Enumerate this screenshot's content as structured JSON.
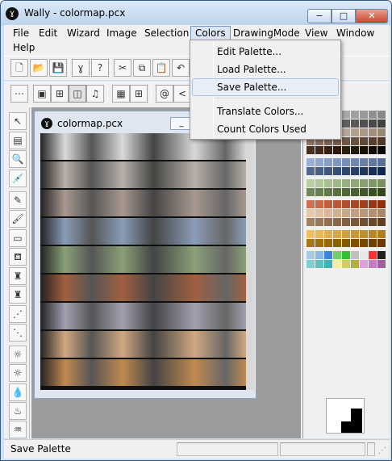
{
  "window": {
    "title": "Wally - colormap.pcx",
    "icon": "wally-logo-icon",
    "minimize": "−",
    "maximize": "□",
    "close": "✕"
  },
  "menubar": {
    "items": [
      "File",
      "Edit",
      "Wizard",
      "Image",
      "Selection",
      "Colors",
      "DrawingMode",
      "View",
      "Window",
      "Help"
    ],
    "active": "Colors"
  },
  "colors_menu": {
    "items": [
      "Edit Palette...",
      "Load Palette...",
      "Save Palette...",
      "Translate Colors...",
      "Count Colors Used"
    ],
    "highlighted": "Save Palette..."
  },
  "toolbar1": {
    "buttons": [
      {
        "name": "new-file-icon",
        "glyph": "🗋"
      },
      {
        "name": "open-folder-icon",
        "glyph": "📂"
      },
      {
        "name": "save-disk-icon",
        "glyph": "💾"
      },
      {
        "name": "wally-icon",
        "glyph": "ɣ"
      },
      {
        "name": "help-icon",
        "glyph": "?"
      },
      {
        "name": "cut-icon",
        "glyph": "✂"
      },
      {
        "name": "copy-icon",
        "glyph": "⧉"
      },
      {
        "name": "paste-icon",
        "glyph": "📋"
      },
      {
        "name": "undo-icon",
        "glyph": "↶"
      }
    ]
  },
  "toolbar2": {
    "buttons": [
      {
        "name": "dots-grid-icon",
        "glyph": "⋯"
      },
      {
        "name": "window-icon",
        "glyph": "▣"
      },
      {
        "name": "grid-icon",
        "glyph": "⊞"
      },
      {
        "name": "tile-icon",
        "glyph": "◫"
      },
      {
        "name": "music-note-icon",
        "glyph": "♫"
      },
      {
        "name": "dense-grid-icon",
        "glyph": "▦"
      },
      {
        "name": "blue-grid-icon",
        "glyph": "⊞"
      },
      {
        "name": "spiral-icon",
        "glyph": "@"
      },
      {
        "name": "arrow-icon",
        "glyph": "<"
      }
    ]
  },
  "tools": [
    {
      "name": "select-arrow-icon",
      "glyph": "↖"
    },
    {
      "name": "ruler-icon",
      "glyph": "▤"
    },
    {
      "name": "zoom-icon",
      "glyph": "🔍"
    },
    {
      "name": "eyedropper-icon",
      "glyph": "💉"
    },
    {
      "name": "pencil-icon",
      "glyph": "✎"
    },
    {
      "name": "brush-icon",
      "glyph": "🖌"
    },
    {
      "name": "eraser-icon",
      "glyph": "▭"
    },
    {
      "name": "fill-bucket-icon",
      "glyph": "⛾"
    },
    {
      "name": "spray-icon",
      "glyph": "♜"
    },
    {
      "name": "spray2-icon",
      "glyph": "♜"
    },
    {
      "name": "scatter-red-icon",
      "glyph": "⋰"
    },
    {
      "name": "scatter-blue-icon",
      "glyph": "⋱"
    },
    {
      "name": "sun-icon",
      "glyph": "☼"
    },
    {
      "name": "sun2-icon",
      "glyph": "☼"
    },
    {
      "name": "drop-icon",
      "glyph": "💧"
    },
    {
      "name": "fountain-icon",
      "glyph": "♨"
    },
    {
      "name": "burn-icon",
      "glyph": "♒"
    }
  ],
  "document": {
    "title": "colormap.pcx",
    "icon": "wally-logo-icon",
    "minimize": "_"
  },
  "canvas_bands": [
    "#d9d9d9",
    "#b8b0a8",
    "#a89890",
    "#8a9cb8",
    "#8aa078",
    "#a06040",
    "#a0a0b0",
    "#d0a880",
    "#c08a50"
  ],
  "palette_rows": [
    [
      "#c8c8c8",
      "#c0c0c0",
      "#b8b8b8",
      "#b0b0b0",
      "#a8a8a8",
      "#a0a0a0",
      "#989898",
      "#909090",
      "#888888"
    ],
    [
      "#808080",
      "#787878",
      "#707070",
      "#686868",
      "#606060",
      "#585858",
      "#505050",
      "#484848",
      "#404040"
    ],
    [
      "#d8c8b8",
      "#d0c0b0",
      "#c8b8a8",
      "#c0b0a0",
      "#b8a898",
      "#b0a090",
      "#a89888",
      "#a09080",
      "#988878"
    ],
    [
      "#907868",
      "#887060",
      "#806858",
      "#786050",
      "#705848",
      "#685040",
      "#604838",
      "#584030",
      "#503828"
    ],
    [
      "#483020",
      "#402818",
      "#382010",
      "#301808",
      "#282010",
      "#201808",
      "#181000",
      "#100800",
      "#080000"
    ],
    [
      "#98b0d8",
      "#90a8d0",
      "#88a0c8",
      "#8098c0",
      "#7890b8",
      "#7088b0",
      "#6880a8",
      "#6078a0",
      "#587098"
    ],
    [
      "#506890",
      "#486088",
      "#405880",
      "#385078",
      "#304870",
      "#284068",
      "#203860",
      "#183058",
      "#102850"
    ],
    [
      "#b8d0a0",
      "#b0c898",
      "#a8c090",
      "#a0b888",
      "#98b080",
      "#90a878",
      "#88a070",
      "#809868",
      "#789060"
    ],
    [
      "#708858",
      "#688050",
      "#607848",
      "#587040",
      "#506838",
      "#486030",
      "#405828",
      "#385020",
      "#304818"
    ],
    [
      "#d07050",
      "#c86848",
      "#c06040",
      "#b85838",
      "#b05030",
      "#a84828",
      "#a04020",
      "#983818",
      "#903010"
    ],
    [
      "#e8c8a8",
      "#e0c0a0",
      "#d8b898",
      "#d0b090",
      "#c8a888",
      "#c0a080",
      "#b89878",
      "#b09070",
      "#a88868"
    ],
    [
      "#a08060",
      "#987858",
      "#907050",
      "#886848",
      "#806040",
      "#785838",
      "#705030",
      "#684828",
      "#604020"
    ],
    [
      "#f0c060",
      "#e8b858",
      "#e0b050",
      "#d8a848",
      "#d0a040",
      "#c89838",
      "#c09030",
      "#b88828",
      "#b08020"
    ],
    [
      "#a87818",
      "#a07010",
      "#986808",
      "#906000",
      "#885800",
      "#805000",
      "#784800",
      "#704000",
      "#683800"
    ],
    [
      "#a8c8e8",
      "#88b8e8",
      "#4080e0",
      "#70d070",
      "#30c030",
      "#c0c0c0",
      "#e8e8e8",
      "#ff3030",
      "#202020"
    ],
    [
      "#80d0d0",
      "#60c0c0",
      "#40b0b0",
      "#f0f0a0",
      "#d0d060",
      "#b0b040",
      "#e0a0e0",
      "#c080c0",
      "#a060a0"
    ]
  ],
  "status": {
    "text": "Save Palette"
  }
}
